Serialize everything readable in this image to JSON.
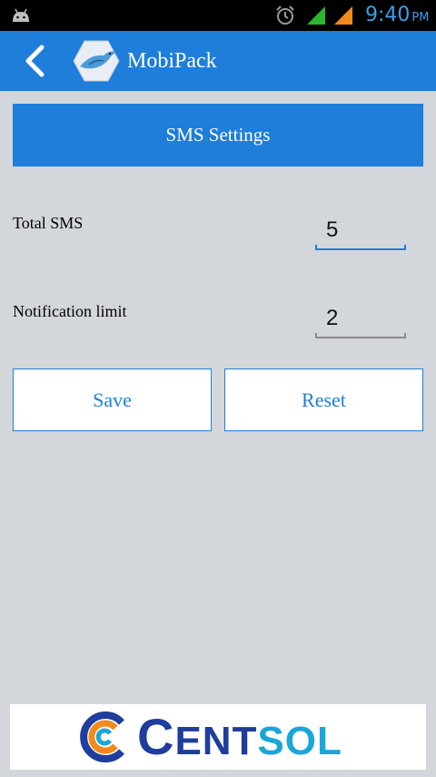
{
  "status_bar": {
    "time": "9:40",
    "ampm": "PM",
    "icons": [
      "android-icon",
      "alarm-icon",
      "signal-icon",
      "signal-icon"
    ],
    "colors": {
      "time": "#3aa0e6",
      "signal_1": "#2db52d",
      "signal_2": "#f08a1c"
    }
  },
  "action_bar": {
    "title": "MobiPack",
    "back_icon": "chevron-left-icon",
    "app_icon": "bird-logo-icon",
    "color": "#1e7ed9"
  },
  "settings": {
    "header": "SMS Settings",
    "fields": [
      {
        "label": "Total SMS",
        "value": "5",
        "focused": true
      },
      {
        "label": "Notification limit",
        "value": "2",
        "focused": false
      }
    ]
  },
  "actions": {
    "save_label": "Save",
    "reset_label": "Reset"
  },
  "footer": {
    "brand_part1": "CENT",
    "brand_part2": "SOL",
    "colors": {
      "part1": "#1f3d9c",
      "part2": "#1aa6d8"
    }
  }
}
